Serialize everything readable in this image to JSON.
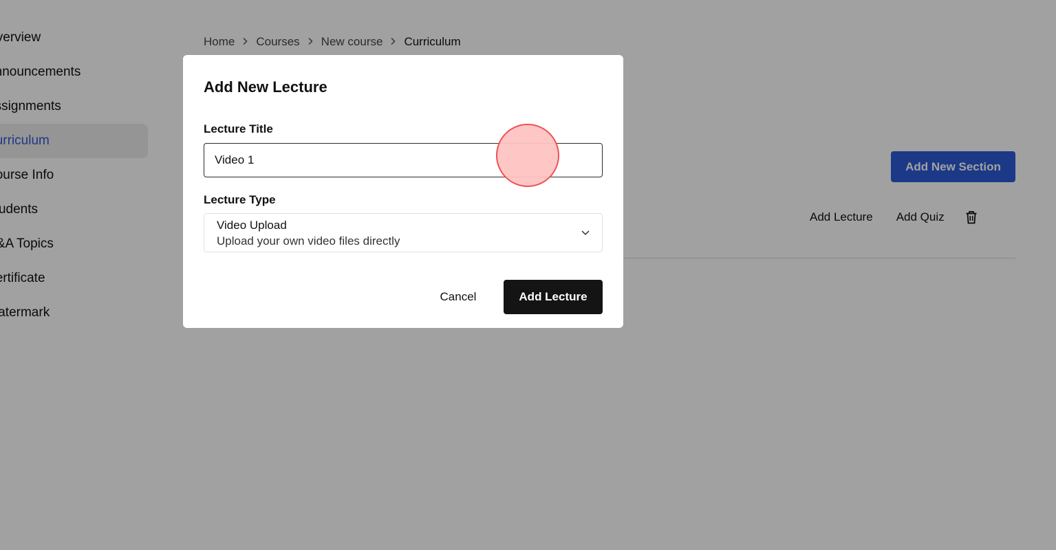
{
  "sidebar": {
    "items": [
      {
        "label": "Overview"
      },
      {
        "label": "Announcements"
      },
      {
        "label": "Assignments"
      },
      {
        "label": "Curriculum",
        "active": true
      },
      {
        "label": "Course Info"
      },
      {
        "label": "Students"
      },
      {
        "label": "Q&A Topics"
      },
      {
        "label": "Certificate"
      },
      {
        "label": "Watermark"
      }
    ]
  },
  "breadcrumb": {
    "items": [
      "Home",
      "Courses",
      "New course",
      "Curriculum"
    ]
  },
  "main": {
    "add_section_label": "Add New Section",
    "section": {
      "add_lecture_label": "Add Lecture",
      "add_quiz_label": "Add Quiz",
      "delete_icon": "trash-icon"
    }
  },
  "modal": {
    "title": "Add New Lecture",
    "title_field": {
      "label": "Lecture Title",
      "value": "Video 1"
    },
    "type_field": {
      "label": "Lecture Type",
      "selected_title": "Video Upload",
      "selected_description": "Upload your own video files directly"
    },
    "cancel_label": "Cancel",
    "submit_label": "Add Lecture"
  },
  "colors": {
    "accent": "#2d5bd7",
    "primary_button": "#141414",
    "click_indicator": "#ef5151"
  }
}
